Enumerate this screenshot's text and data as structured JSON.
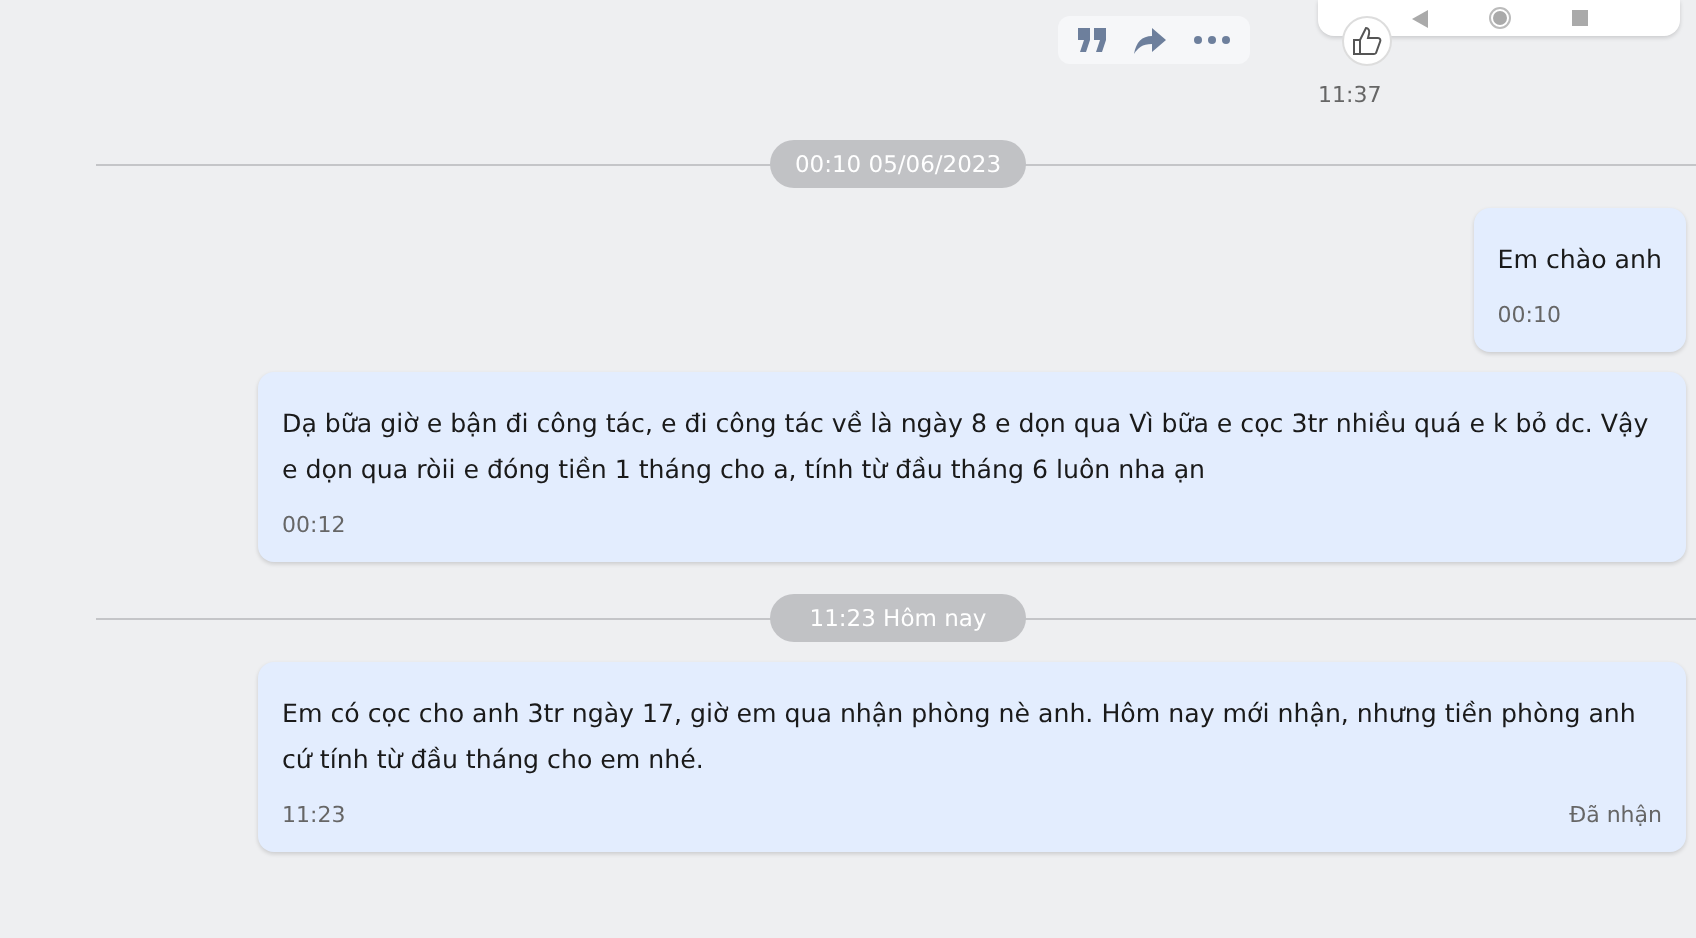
{
  "top_message": {
    "time": "11:37"
  },
  "sections": [
    {
      "divider": "00:10 05/06/2023",
      "messages": [
        {
          "kind": "sent",
          "text": "Em chào anh",
          "time": "00:10"
        },
        {
          "kind": "received",
          "text": "Dạ bữa giờ e bận đi công tác, e đi công tác về là ngày 8 e dọn qua Vì bữa e cọc 3tr nhiều quá e k bỏ dc. Vậy e dọn qua ròii e đóng tiền 1 tháng cho a, tính từ đầu tháng 6 luôn nha ạn",
          "time": "00:12"
        }
      ]
    },
    {
      "divider": "11:23 Hôm nay",
      "messages": [
        {
          "kind": "received",
          "text": "Em có cọc cho anh 3tr ngày 17, giờ em qua nhận phòng nè anh. Hôm nay mới nhận, nhưng tiền phòng anh cứ tính từ đầu tháng cho em nhé.",
          "time": "11:23",
          "status": "Đã nhận"
        }
      ]
    }
  ]
}
